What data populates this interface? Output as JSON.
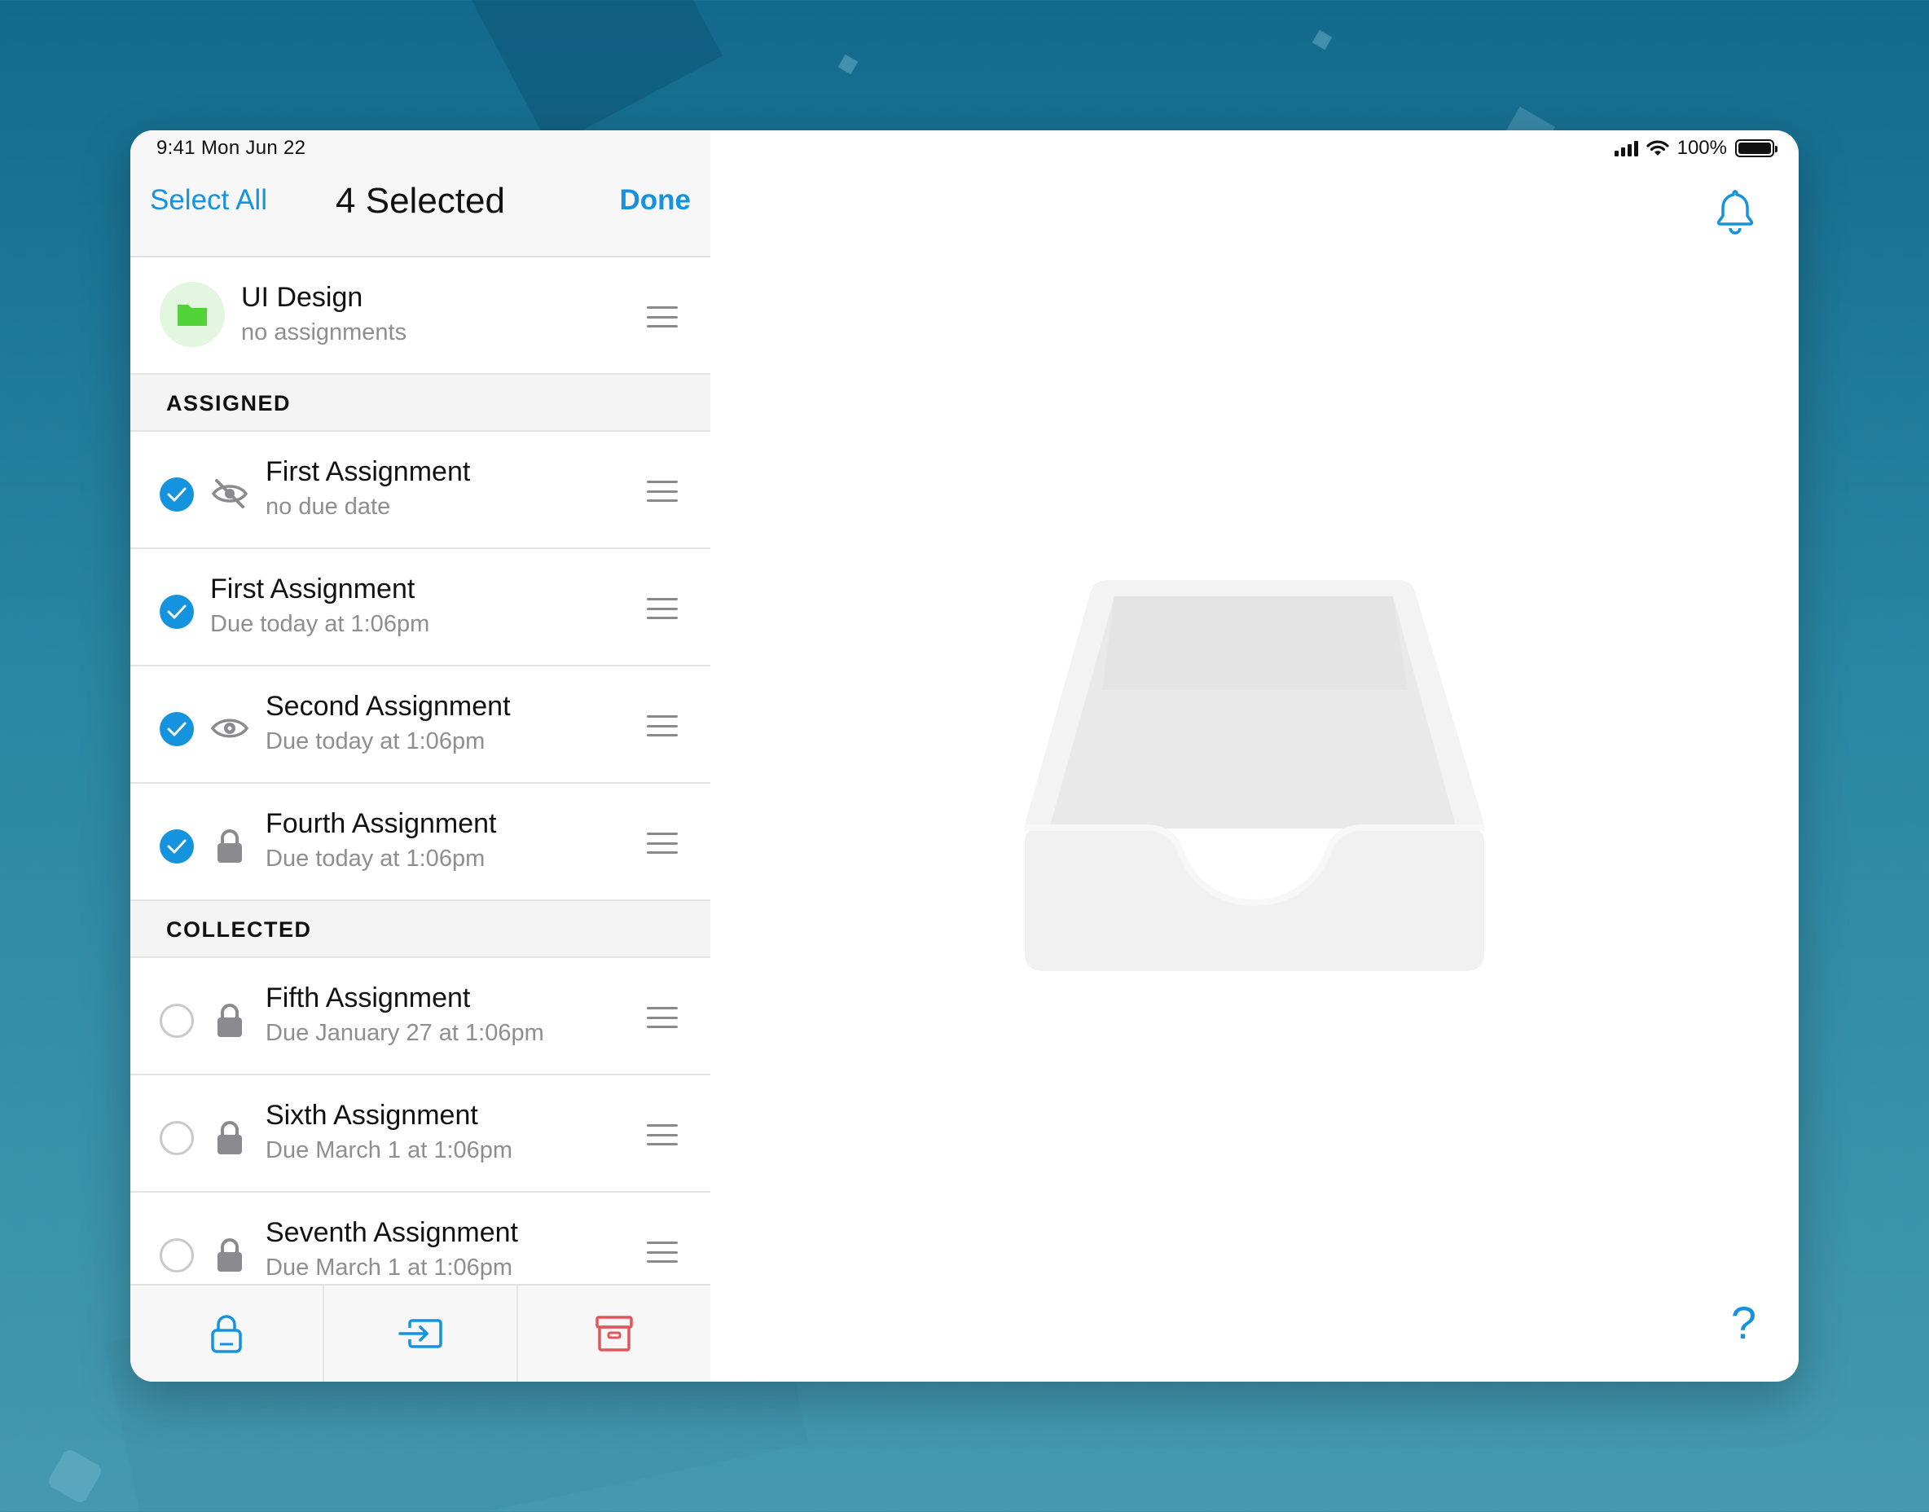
{
  "status_bar": {
    "time_date": "9:41  Mon Jun 22",
    "battery": "100%"
  },
  "navbar": {
    "select_all": "Select All",
    "title": "4 Selected",
    "done": "Done"
  },
  "folder": {
    "title": "UI Design",
    "subtitle": "no assignments",
    "color": "#52d33a"
  },
  "sections": {
    "assigned": "ASSIGNED",
    "collected": "COLLECTED"
  },
  "assigned": [
    {
      "title": "First Assignment",
      "subtitle": "no due date",
      "selected": true,
      "status_icon": "eye-slash-icon"
    },
    {
      "title": "First Assignment",
      "subtitle": "Due today at 1:06pm",
      "selected": true,
      "status_icon": "none"
    },
    {
      "title": "Second Assignment",
      "subtitle": "Due today at 1:06pm",
      "selected": true,
      "status_icon": "eye-icon"
    },
    {
      "title": "Fourth Assignment",
      "subtitle": "Due today at 1:06pm",
      "selected": true,
      "status_icon": "lock-icon"
    }
  ],
  "collected": [
    {
      "title": "Fifth Assignment",
      "subtitle": "Due January 27 at 1:06pm",
      "selected": false,
      "status_icon": "lock-icon"
    },
    {
      "title": "Sixth Assignment",
      "subtitle": "Due March 1 at 1:06pm",
      "selected": false,
      "status_icon": "lock-icon"
    },
    {
      "title": "Seventh Assignment",
      "subtitle": "Due March 1 at 1:06pm",
      "selected": false,
      "status_icon": "lock-icon"
    }
  ],
  "toolbar": {
    "icons": [
      "lock-icon",
      "move-to-icon",
      "archive-icon"
    ]
  },
  "detail": {
    "help": "?",
    "bell_icon": "bell-icon",
    "empty_icon": "inbox-tray-icon"
  },
  "colors": {
    "accent": "#1593de",
    "destructive": "#e0575b",
    "muted": "#8e8e8e"
  }
}
